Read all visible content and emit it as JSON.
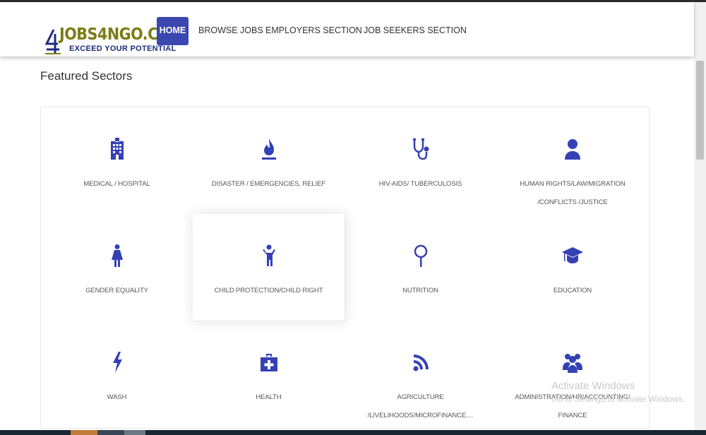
{
  "header": {
    "logo_title": "JOBS4NGO.COM",
    "logo_tagline": "EXCEED YOUR POTENTIAL",
    "nav": [
      "HOME",
      "BROWSE JOBS",
      "EMPLOYERS SECTION",
      "JOB SEEKERS SECTION"
    ],
    "active_nav": "HOME"
  },
  "main": {
    "section_title": "Featured Sectors",
    "sectors": [
      {
        "label": "MEDICAL / HOSPITAL",
        "icon": "hospital-icon"
      },
      {
        "label": "DISASTER / EMERGENCIES, RELIEF",
        "icon": "fire-icon"
      },
      {
        "label": "HIV-AIDS/ TUBERCULOSIS",
        "icon": "stethoscope-icon"
      },
      {
        "label": "HUMAN RIGHTS/LAW/MIGRATION /CONFLICTS /JUSTICE",
        "icon": "user-icon"
      },
      {
        "label": "GENDER EQUALITY",
        "icon": "female-icon"
      },
      {
        "label": "CHILD PROTECTION/CHILD RIGHT",
        "icon": "child-icon"
      },
      {
        "label": "NUTRITION",
        "icon": "lollipop-icon"
      },
      {
        "label": "EDUCATION",
        "icon": "graduation-cap-icon"
      },
      {
        "label": "WASH",
        "icon": "lightning-icon"
      },
      {
        "label": "HEALTH",
        "icon": "medkit-icon"
      },
      {
        "label": "AGRICULTURE /LIVELIHOODS/MICROFINANCE....",
        "icon": "rss-icon"
      },
      {
        "label": "ADMINISTRATION/HR/ACCOUNTING/ FINANCE",
        "icon": "users-icon"
      }
    ]
  },
  "watermark": {
    "line1": "Activate Windows",
    "line2": "Go to Settings to activate Windows."
  },
  "colors": {
    "accent": "#3b47b0",
    "icon": "#3441b5",
    "logo_green": "#7c7d16",
    "logo_blue": "#1f2b7c"
  }
}
